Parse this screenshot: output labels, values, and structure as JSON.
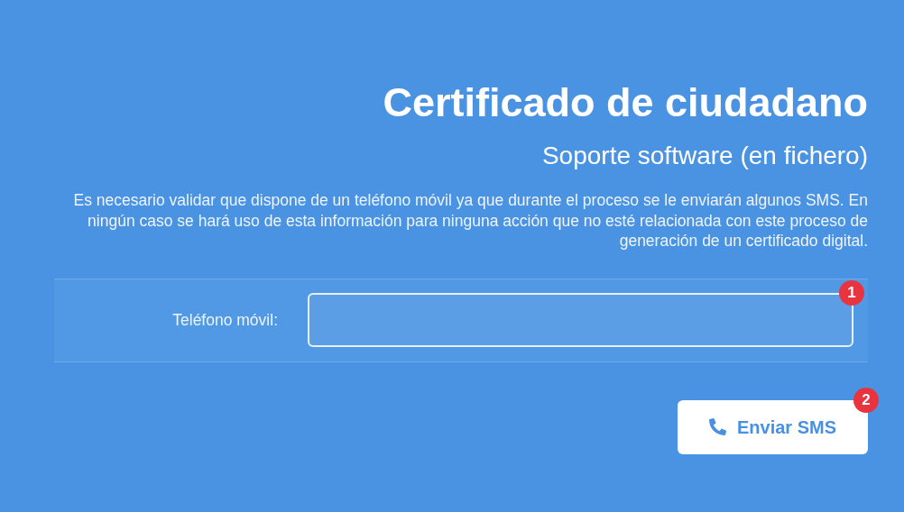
{
  "title": "Certificado de ciudadano",
  "subtitle": "Soporte software (en fichero)",
  "description": "Es necesario validar que dispone de un teléfono móvil ya que durante el proceso se le enviarán algunos SMS. En ningún caso se hará uso de esta información para ninguna acción que no esté relacionada con este proceso de generación de un certificado digital.",
  "phone_field": {
    "label": "Teléfono móvil:",
    "badge": "1"
  },
  "send_button": {
    "label": "Enviar SMS",
    "badge": "2"
  }
}
